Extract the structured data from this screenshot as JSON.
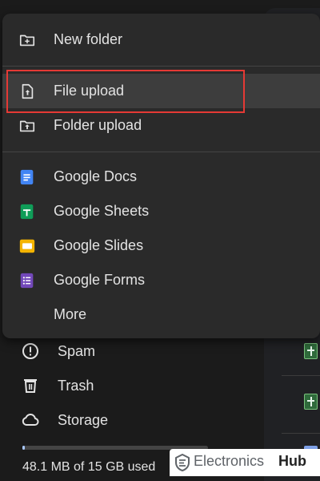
{
  "menu": {
    "items": [
      {
        "label": "New folder",
        "icon": "new-folder-icon"
      },
      {
        "label": "File upload",
        "icon": "file-upload-icon"
      },
      {
        "label": "Folder upload",
        "icon": "folder-upload-icon"
      },
      {
        "label": "Google Docs",
        "icon": "google-docs-icon"
      },
      {
        "label": "Google Sheets",
        "icon": "google-sheets-icon"
      },
      {
        "label": "Google Slides",
        "icon": "google-slides-icon"
      },
      {
        "label": "Google Forms",
        "icon": "google-forms-icon"
      },
      {
        "label": "More",
        "icon": ""
      }
    ],
    "highlighted": "File upload"
  },
  "sidebar": {
    "items": [
      {
        "label": "Spam",
        "icon": "spam-icon"
      },
      {
        "label": "Trash",
        "icon": "trash-icon"
      },
      {
        "label": "Storage",
        "icon": "cloud-icon"
      }
    ]
  },
  "storage": {
    "text": "48.1 MB of 15 GB used",
    "fraction_used": 0.003
  },
  "watermark": {
    "brand_a": "Electronics",
    "brand_b": "Hub"
  },
  "colors": {
    "docs": "#4285f4",
    "sheets": "#0f9d58",
    "slides": "#f4b400",
    "forms": "#7248b9",
    "highlight_border": "#e53935"
  }
}
